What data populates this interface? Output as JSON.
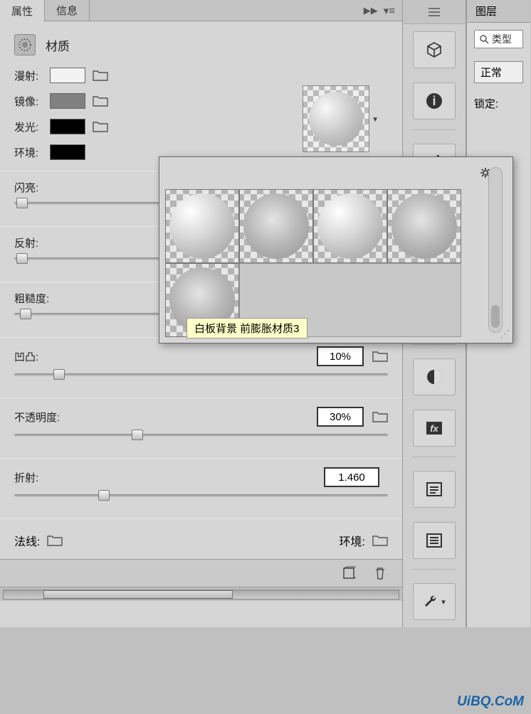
{
  "tabs": {
    "properties": "属性",
    "info": "信息"
  },
  "panel": {
    "title": "材质"
  },
  "props": {
    "diffuse": {
      "label": "漫射:",
      "color": "#f2f2f2"
    },
    "specular": {
      "label": "镜像:",
      "color": "#808080"
    },
    "glow": {
      "label": "发光:",
      "color": "#000000"
    },
    "ambient": {
      "label": "环境:",
      "color": "#000000"
    }
  },
  "sliders": {
    "shine": {
      "label": "闪亮:",
      "pos": 2
    },
    "reflect": {
      "label": "反射:",
      "pos": 2
    },
    "rough": {
      "label": "粗糙度:",
      "pos": 3
    },
    "bump": {
      "label": "凹凸:",
      "value": "10%",
      "pos": 12
    },
    "opacity": {
      "label": "不透明度:",
      "value": "30%",
      "pos": 33
    },
    "refract": {
      "label": "折射:",
      "value": "1.460",
      "pos": 24
    }
  },
  "bottom": {
    "normal": "法线:",
    "env": "环境:"
  },
  "popup": {
    "tooltip": "白板背景 前膨胀材质3"
  },
  "layers": {
    "title": "图层",
    "search_placeholder": "类型",
    "blend": "正常",
    "lock": "锁定:"
  },
  "watermark": "UiBQ.CoM"
}
